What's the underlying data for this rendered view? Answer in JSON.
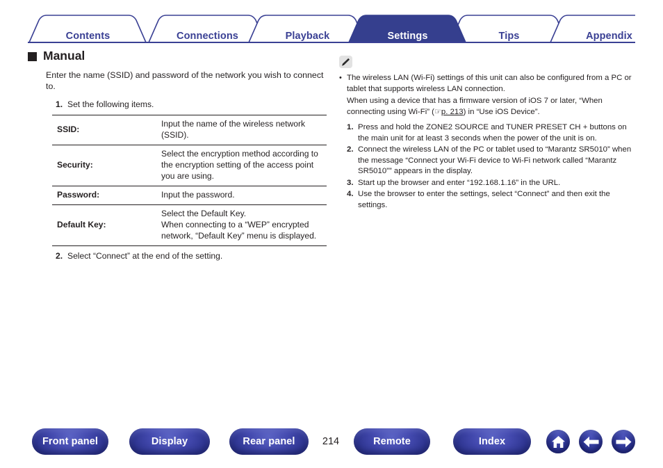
{
  "tabs": [
    {
      "label": "Contents",
      "active": false
    },
    {
      "label": "Connections",
      "active": false
    },
    {
      "label": "Playback",
      "active": false
    },
    {
      "label": "Settings",
      "active": true
    },
    {
      "label": "Tips",
      "active": false
    },
    {
      "label": "Appendix",
      "active": false
    }
  ],
  "left": {
    "heading": "Manual",
    "intro": "Enter the name (SSID) and password of the network you wish to connect to.",
    "step1": {
      "num": "1.",
      "text": "Set the following items."
    },
    "table": [
      {
        "key": "SSID:",
        "value": "Input the name of the wireless network (SSID)."
      },
      {
        "key": "Security:",
        "value": "Select the encryption method according to the encryption setting of the access point you are using."
      },
      {
        "key": "Password:",
        "value": "Input the password."
      },
      {
        "key": "Default Key:",
        "value_line1": "Select the Default Key.",
        "value_line2": "When connecting to a “WEP” encrypted network, “Default Key” menu is displayed."
      }
    ],
    "step2": {
      "num": "2.",
      "text": "Select “Connect” at the end of the setting."
    }
  },
  "right": {
    "note_icon": "pencil-icon",
    "bullet_line1": "The wireless LAN (Wi-Fi) settings of this unit can also be configured from a PC or tablet that supports wireless LAN connection.",
    "bullet_line2_pre": "When using a device that has a firmware version of iOS 7 or later, “When connecting using Wi-Fi” (",
    "bullet_hand": "☞",
    "bullet_link": "p. 213",
    "bullet_line2_post": ") in “Use iOS Device”.",
    "steps": [
      {
        "num": "1.",
        "text": "Press and hold the ZONE2 SOURCE and TUNER PRESET CH + buttons on the main unit for at least 3 seconds when the power of the unit is on."
      },
      {
        "num": "2.",
        "text": "Connect the wireless LAN of the PC or tablet used to “Marantz SR5010” when the message “Connect your Wi-Fi device to Wi-Fi network called “Marantz SR5010”” appears in the display."
      },
      {
        "num": "3.",
        "text": "Start up the browser and enter “192.168.1.16” in the URL."
      },
      {
        "num": "4.",
        "text": "Use the browser to enter the settings, select “Connect” and then exit the settings."
      }
    ]
  },
  "footer": {
    "buttons": [
      {
        "label": "Front panel"
      },
      {
        "label": "Display"
      },
      {
        "label": "Rear panel"
      },
      {
        "label": "Remote"
      },
      {
        "label": "Index"
      }
    ],
    "page_number": "214",
    "icons": [
      {
        "name": "home-icon"
      },
      {
        "name": "back-arrow-icon"
      },
      {
        "name": "forward-arrow-icon"
      }
    ]
  },
  "colors": {
    "brand_blue": "#3a4094",
    "active_tab": "#353f8e",
    "text": "#231f20",
    "note_bg": "#e2e2e2"
  }
}
